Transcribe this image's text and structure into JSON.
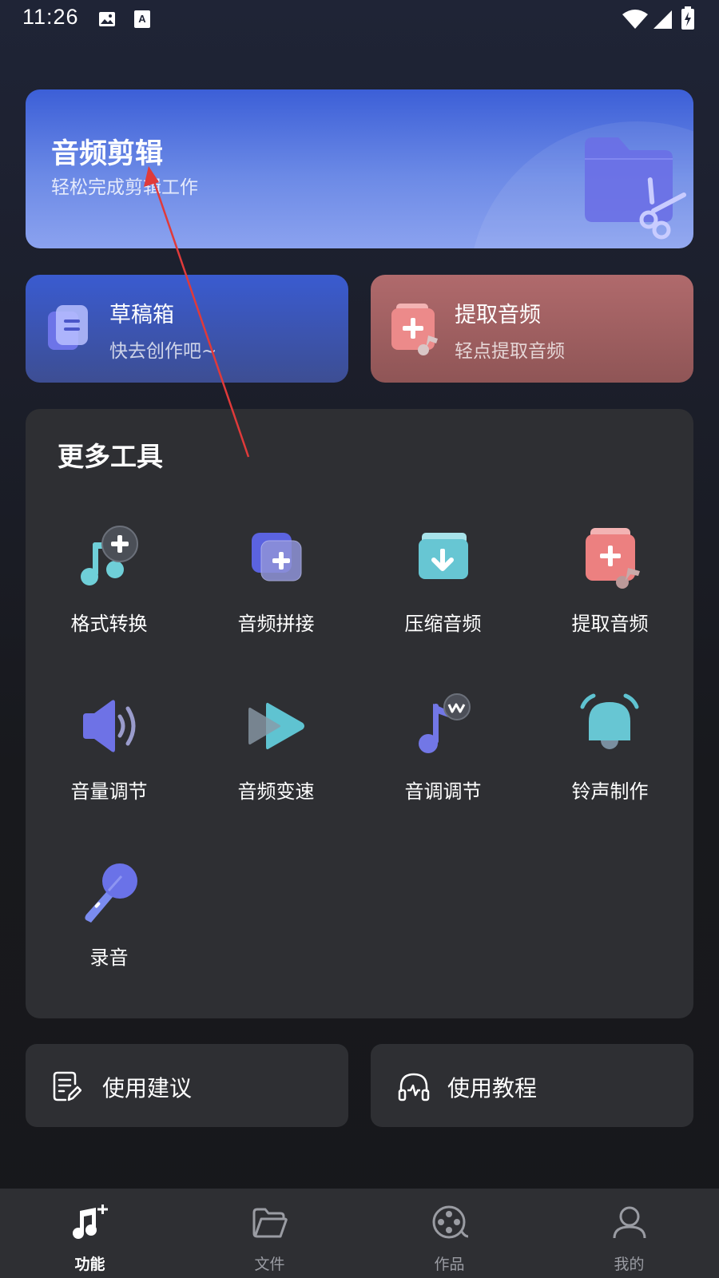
{
  "status_bar": {
    "time": "11:26"
  },
  "banner": {
    "title": "音频剪辑",
    "subtitle": "轻松完成剪辑工作"
  },
  "cards": {
    "draft": {
      "title": "草稿箱",
      "subtitle": "快去创作吧~"
    },
    "extract": {
      "title": "提取音频",
      "subtitle": "轻点提取音频"
    }
  },
  "tools": {
    "heading": "更多工具",
    "items": [
      {
        "label": "格式转换",
        "icon": "music-note-plus-icon"
      },
      {
        "label": "音频拼接",
        "icon": "layers-plus-icon"
      },
      {
        "label": "压缩音频",
        "icon": "box-download-icon"
      },
      {
        "label": "提取音频",
        "icon": "document-music-plus-icon"
      },
      {
        "label": "音量调节",
        "icon": "speaker-volume-icon"
      },
      {
        "label": "音频变速",
        "icon": "play-fast-icon"
      },
      {
        "label": "音调调节",
        "icon": "music-note-wave-icon"
      },
      {
        "label": "铃声制作",
        "icon": "bell-icon"
      },
      {
        "label": "录音",
        "icon": "microphone-icon"
      }
    ]
  },
  "bottom_buttons": [
    {
      "label": "使用建议",
      "icon": "feedback-edit-icon"
    },
    {
      "label": "使用教程",
      "icon": "headphones-icon"
    }
  ],
  "tabbar": {
    "items": [
      {
        "label": "功能",
        "icon": "music-note-plus-icon",
        "active": true
      },
      {
        "label": "文件",
        "icon": "folder-icon",
        "active": false
      },
      {
        "label": "作品",
        "icon": "film-reel-icon",
        "active": false
      },
      {
        "label": "我的",
        "icon": "person-icon",
        "active": false
      }
    ]
  },
  "colors": {
    "banner": "#5b7ae0",
    "draft_card": "#3a55b8",
    "extract_card": "#a05f61",
    "panel": "#2e2f33",
    "annotation_arrow": "#e03a3a"
  }
}
